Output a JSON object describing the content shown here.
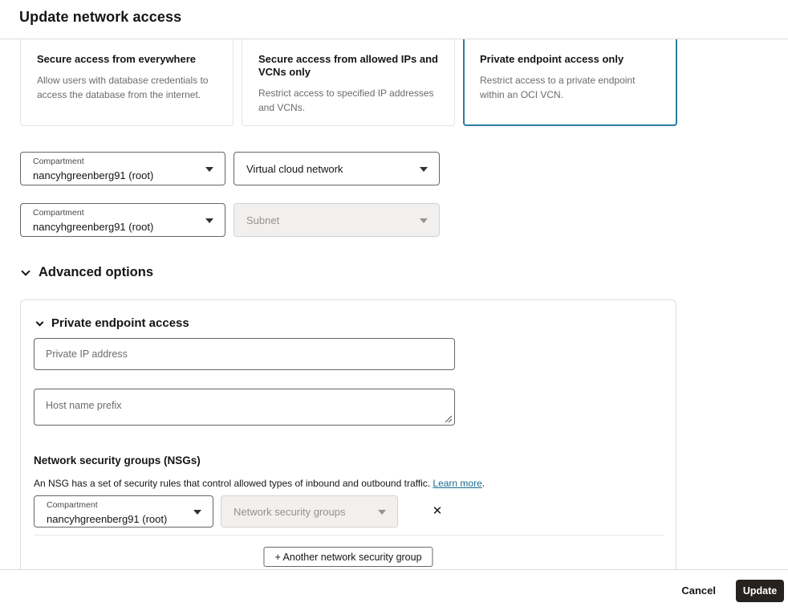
{
  "dialog": {
    "title": "Update network access"
  },
  "access_options": {
    "cards": [
      {
        "title": "Secure access from everywhere",
        "description": "Allow users with database credentials to access the database from the internet.",
        "selected": false
      },
      {
        "title": "Secure access from allowed IPs and VCNs only",
        "description": "Restrict access to specified IP addresses and VCNs.",
        "selected": false
      },
      {
        "title": "Private endpoint access only",
        "description": "Restrict access to a private endpoint within an OCI VCN.",
        "selected": true
      }
    ]
  },
  "network_section": {
    "vcn_compartment": {
      "label": "Compartment",
      "value": "nancyhgreenberg91 (root)"
    },
    "vcn_select": {
      "placeholder": "Virtual cloud network"
    },
    "subnet_compartment": {
      "label": "Compartment",
      "value": "nancyhgreenberg91 (root)"
    },
    "subnet_select": {
      "placeholder": "Subnet"
    }
  },
  "advanced": {
    "title": "Advanced options",
    "private_endpoint": {
      "title": "Private endpoint access",
      "private_ip_placeholder": "Private IP address",
      "host_prefix_placeholder": "Host name prefix"
    },
    "nsg": {
      "heading": "Network security groups (NSGs)",
      "description": "An NSG has a set of security rules that control allowed types of inbound and outbound traffic. ",
      "learn_more_label": "Learn more",
      "period": ".",
      "compartment": {
        "label": "Compartment",
        "value": "nancyhgreenberg91 (root)"
      },
      "nsg_select": {
        "placeholder": "Network security groups"
      },
      "add_button_label": "+ Another network security group"
    }
  },
  "footer": {
    "cancel_label": "Cancel",
    "update_label": "Update"
  },
  "icons": {
    "close": "✕"
  },
  "colors": {
    "accent_blue": "#2b7da2",
    "link": "#1a6b8f",
    "primary_button": "#252220"
  }
}
